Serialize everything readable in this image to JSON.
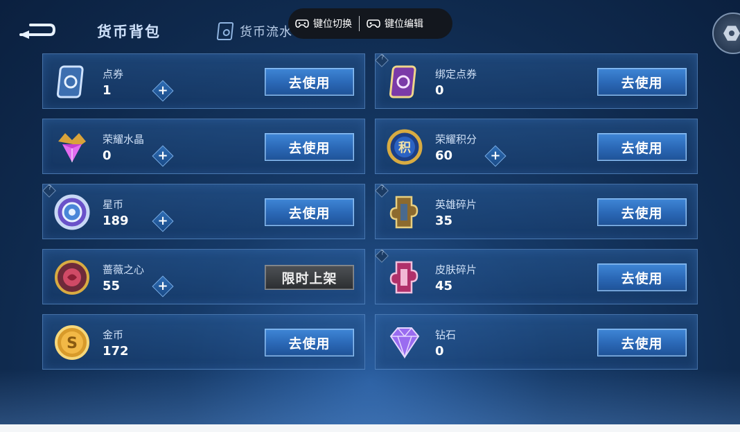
{
  "header": {
    "title": "货币背包",
    "tab_flow_label": "货币流水"
  },
  "overlay": {
    "switch_label": "键位切换",
    "edit_label": "键位编辑"
  },
  "currencies": [
    {
      "name": "点券",
      "amount": "1",
      "has_plus": true,
      "button": "去使用",
      "icon": "voucher-icon",
      "help": false
    },
    {
      "name": "绑定点券",
      "amount": "0",
      "has_plus": false,
      "button": "去使用",
      "icon": "bound-voucher-icon",
      "help": true
    },
    {
      "name": "荣耀水晶",
      "amount": "0",
      "has_plus": true,
      "button": "去使用",
      "icon": "glory-crystal-icon",
      "help": false
    },
    {
      "name": "荣耀积分",
      "amount": "60",
      "has_plus": true,
      "button": "去使用",
      "icon": "glory-points-icon",
      "help": false
    },
    {
      "name": "星币",
      "amount": "189",
      "has_plus": true,
      "button": "去使用",
      "icon": "star-coin-icon",
      "help": true
    },
    {
      "name": "英雄碎片",
      "amount": "35",
      "has_plus": false,
      "button": "去使用",
      "icon": "hero-shard-icon",
      "help": true
    },
    {
      "name": "蔷薇之心",
      "amount": "55",
      "has_plus": true,
      "button": "限时上架",
      "icon": "rose-heart-icon",
      "help": false
    },
    {
      "name": "皮肤碎片",
      "amount": "45",
      "has_plus": false,
      "button": "去使用",
      "icon": "skin-shard-icon",
      "help": true
    },
    {
      "name": "金币",
      "amount": "172",
      "has_plus": false,
      "button": "去使用",
      "icon": "gold-coin-icon",
      "help": false
    },
    {
      "name": "钻石",
      "amount": "0",
      "has_plus": false,
      "button": "去使用",
      "icon": "diamond-icon",
      "help": false
    }
  ],
  "colors": {
    "accent": "#3f86d6",
    "background": "#163a68"
  }
}
